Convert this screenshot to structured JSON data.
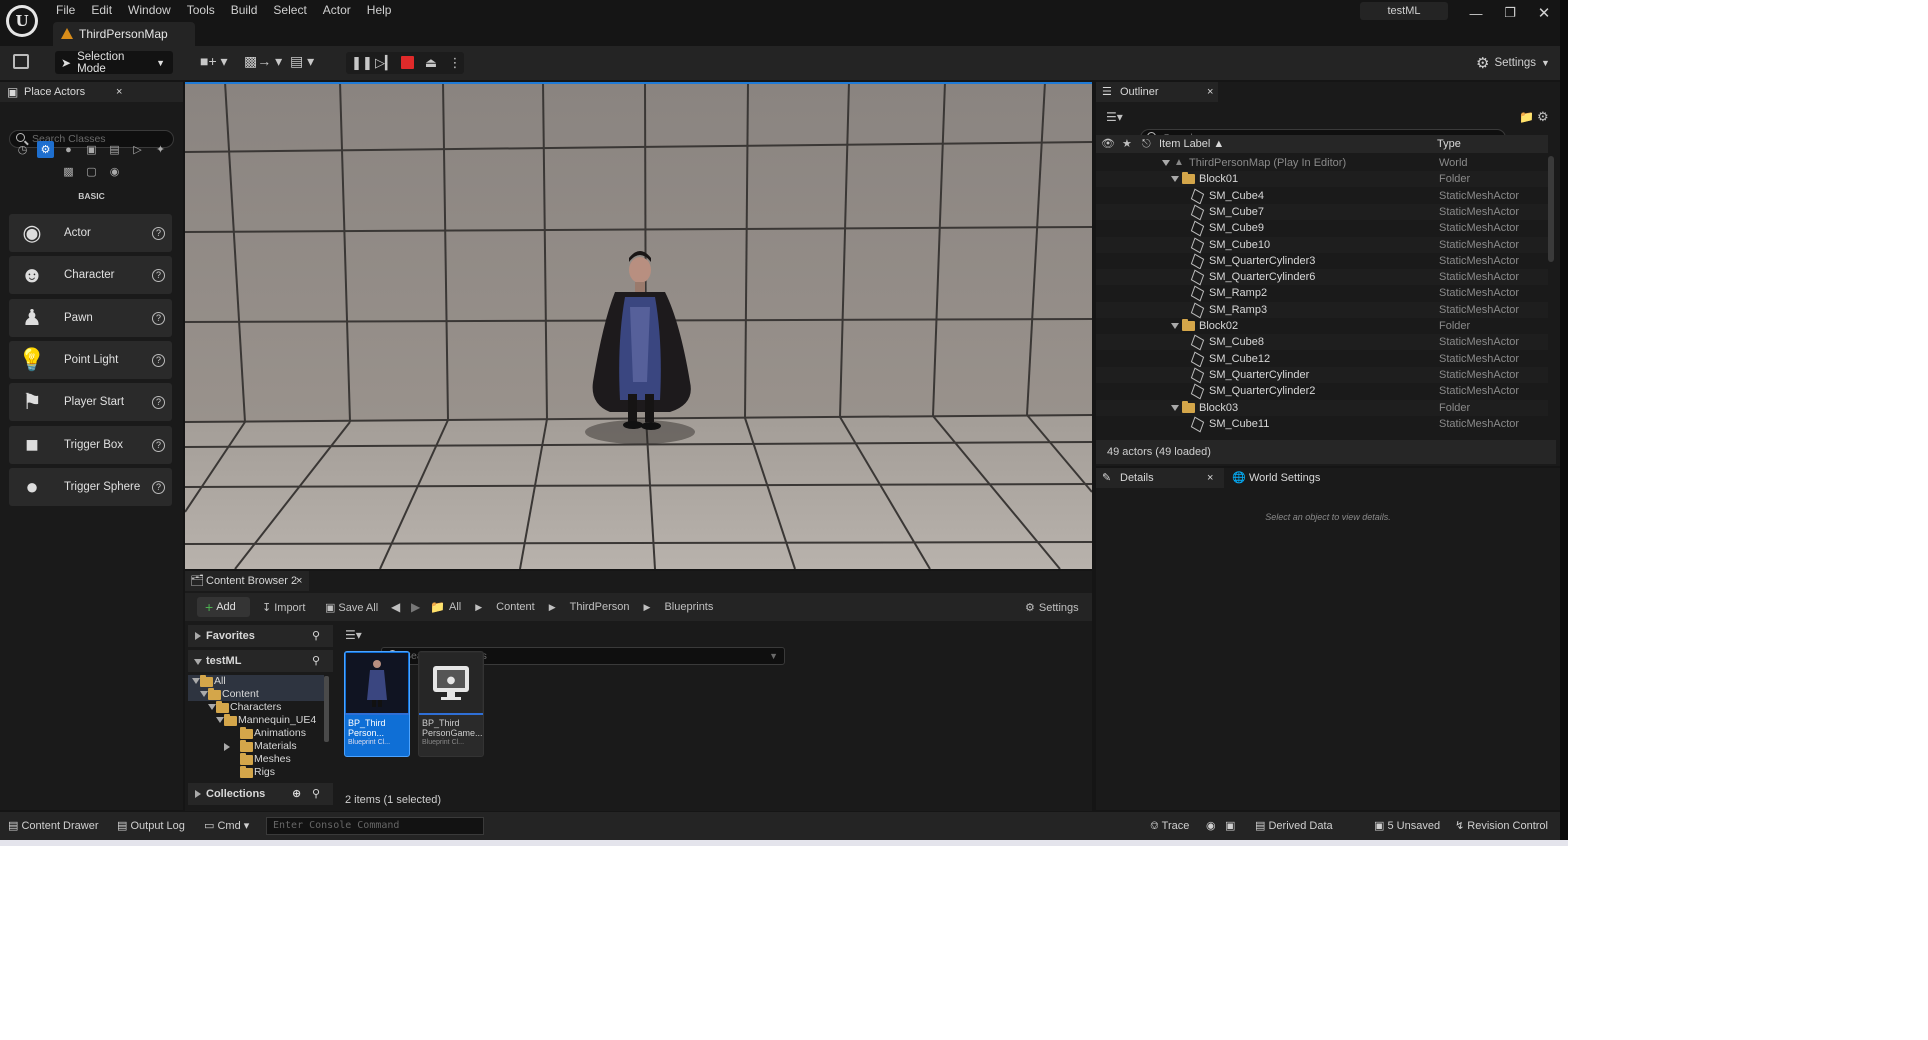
{
  "menu": [
    "File",
    "Edit",
    "Window",
    "Tools",
    "Build",
    "Select",
    "Actor",
    "Help"
  ],
  "map_tab": "ThirdPersonMap",
  "project_name": "testML",
  "toolbar": {
    "selection_mode": "Selection Mode",
    "settings": "Settings"
  },
  "place_actors": {
    "tab": "Place Actors",
    "search_placeholder": "Search Classes",
    "category": "BASIC",
    "items": [
      "Actor",
      "Character",
      "Pawn",
      "Point Light",
      "Player Start",
      "Trigger Box",
      "Trigger Sphere"
    ]
  },
  "outliner": {
    "tab": "Outliner",
    "search_placeholder": "Search...",
    "col_label": "Item Label",
    "col_type": "Type",
    "rows": [
      {
        "name": "ThirdPersonMap (Play In Editor)",
        "type": "World",
        "kind": "world"
      },
      {
        "name": "Block01",
        "type": "Folder",
        "kind": "folder"
      },
      {
        "name": "SM_Cube4",
        "type": "StaticMeshActor",
        "kind": "mesh"
      },
      {
        "name": "SM_Cube7",
        "type": "StaticMeshActor",
        "kind": "mesh"
      },
      {
        "name": "SM_Cube9",
        "type": "StaticMeshActor",
        "kind": "mesh"
      },
      {
        "name": "SM_Cube10",
        "type": "StaticMeshActor",
        "kind": "mesh"
      },
      {
        "name": "SM_QuarterCylinder3",
        "type": "StaticMeshActor",
        "kind": "mesh"
      },
      {
        "name": "SM_QuarterCylinder6",
        "type": "StaticMeshActor",
        "kind": "mesh"
      },
      {
        "name": "SM_Ramp2",
        "type": "StaticMeshActor",
        "kind": "mesh"
      },
      {
        "name": "SM_Ramp3",
        "type": "StaticMeshActor",
        "kind": "mesh"
      },
      {
        "name": "Block02",
        "type": "Folder",
        "kind": "folder"
      },
      {
        "name": "SM_Cube8",
        "type": "StaticMeshActor",
        "kind": "mesh"
      },
      {
        "name": "SM_Cube12",
        "type": "StaticMeshActor",
        "kind": "mesh"
      },
      {
        "name": "SM_QuarterCylinder",
        "type": "StaticMeshActor",
        "kind": "mesh"
      },
      {
        "name": "SM_QuarterCylinder2",
        "type": "StaticMeshActor",
        "kind": "mesh"
      },
      {
        "name": "Block03",
        "type": "Folder",
        "kind": "folder"
      },
      {
        "name": "SM_Cube11",
        "type": "StaticMeshActor",
        "kind": "mesh"
      }
    ],
    "footer": "49 actors (49 loaded)"
  },
  "details": {
    "tab": "Details",
    "world_tab": "World Settings",
    "empty_msg": "Select an object to view details."
  },
  "content_browser": {
    "tab": "Content Browser 2",
    "add": "Add",
    "import": "Import",
    "save_all": "Save All",
    "breadcrumb": [
      "All",
      "Content",
      "ThirdPerson",
      "Blueprints"
    ],
    "settings": "Settings",
    "favorites": "Favorites",
    "project": "testML",
    "tree": [
      "All",
      "Content",
      "Characters",
      "Mannequin_UE4",
      "Animations",
      "Materials",
      "Meshes",
      "Rigs"
    ],
    "collections": "Collections",
    "search_placeholder": "Search Blueprints",
    "assets": [
      {
        "line1": "BP_Third",
        "line2": "Person...",
        "kind": "Blueprint Cl..."
      },
      {
        "line1": "BP_Third",
        "line2": "PersonGame...",
        "kind": "Blueprint Cl..."
      }
    ],
    "status": "2 items (1 selected)"
  },
  "statusbar": {
    "content_drawer": "Content Drawer",
    "output_log": "Output Log",
    "cmd": "Cmd",
    "console_placeholder": "Enter Console Command",
    "trace": "Trace",
    "derived_data": "Derived Data",
    "unsaved": "5 Unsaved",
    "revision_control": "Revision Control"
  },
  "colors": {
    "selected_blue": "#0f6fd6",
    "stop_red": "#e02a2a",
    "folder": "#d4a64a"
  }
}
